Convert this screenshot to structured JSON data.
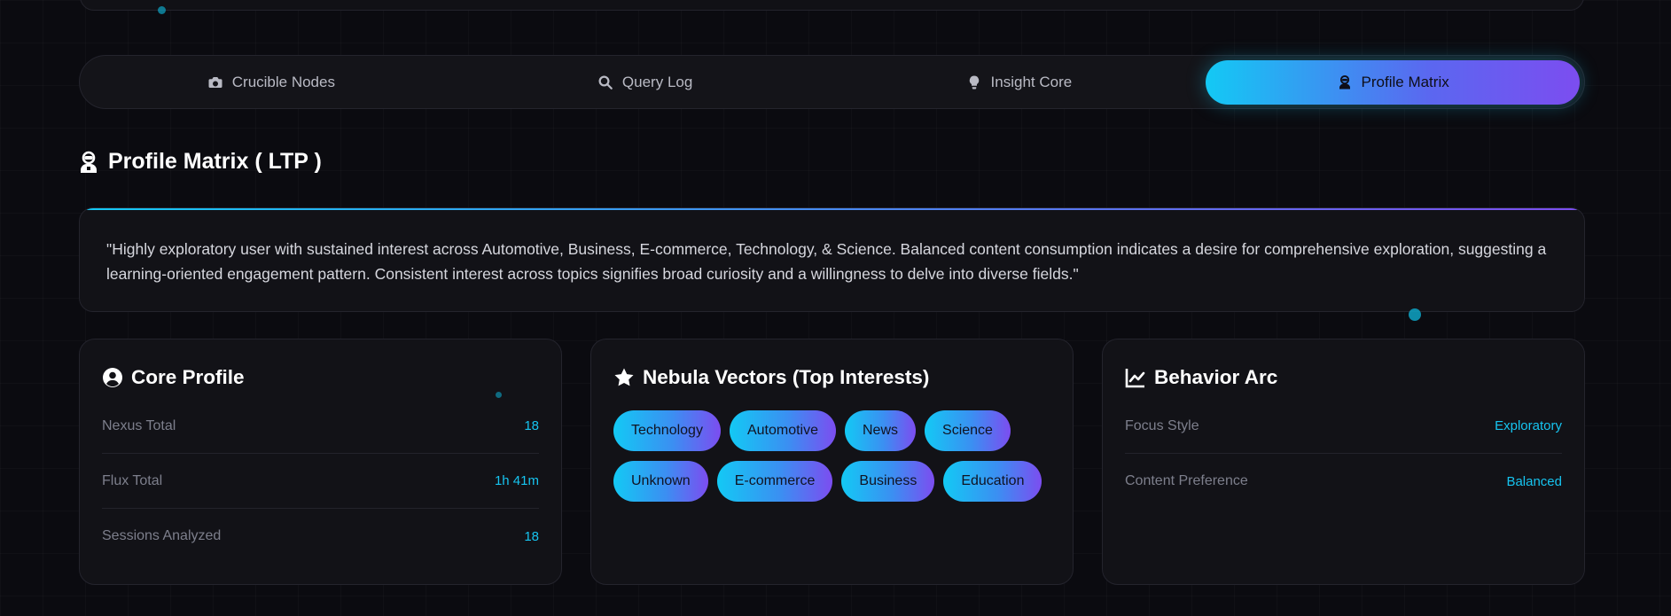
{
  "tabs": [
    {
      "label": "Crucible Nodes",
      "icon": "camera-icon",
      "active": false
    },
    {
      "label": "Query Log",
      "icon": "search-icon",
      "active": false
    },
    {
      "label": "Insight Core",
      "icon": "lightbulb-icon",
      "active": false
    },
    {
      "label": "Profile Matrix",
      "icon": "user-astronaut-icon",
      "active": true
    }
  ],
  "section": {
    "title": "Profile Matrix ( LTP )"
  },
  "summary": {
    "text": "\"Highly exploratory user with sustained interest across Automotive, Business, E-commerce, Technology, & Science. Balanced content consumption indicates a desire for comprehensive exploration, suggesting a learning-oriented engagement pattern. Consistent interest across topics signifies broad curiosity and a willingness to delve into diverse fields.\""
  },
  "core_profile": {
    "title": "Core Profile",
    "icon": "user-circle-icon",
    "rows": [
      {
        "label": "Nexus Total",
        "value": "18"
      },
      {
        "label": "Flux Total",
        "value": "1h 41m"
      },
      {
        "label": "Sessions Analyzed",
        "value": "18"
      }
    ]
  },
  "nebula": {
    "title": "Nebula Vectors (Top Interests)",
    "icon": "star-icon",
    "tags": [
      "Technology",
      "Automotive",
      "News",
      "Science",
      "Unknown",
      "E-commerce",
      "Business",
      "Education"
    ]
  },
  "behavior": {
    "title": "Behavior Arc",
    "icon": "line-chart-icon",
    "rows": [
      {
        "label": "Focus Style",
        "value": "Exploratory"
      },
      {
        "label": "Content Preference",
        "value": "Balanced"
      }
    ]
  },
  "colors": {
    "accent_cyan": "#13c9f4",
    "accent_purple": "#7c4df0",
    "background": "#0b0b10",
    "card": "#121217"
  }
}
